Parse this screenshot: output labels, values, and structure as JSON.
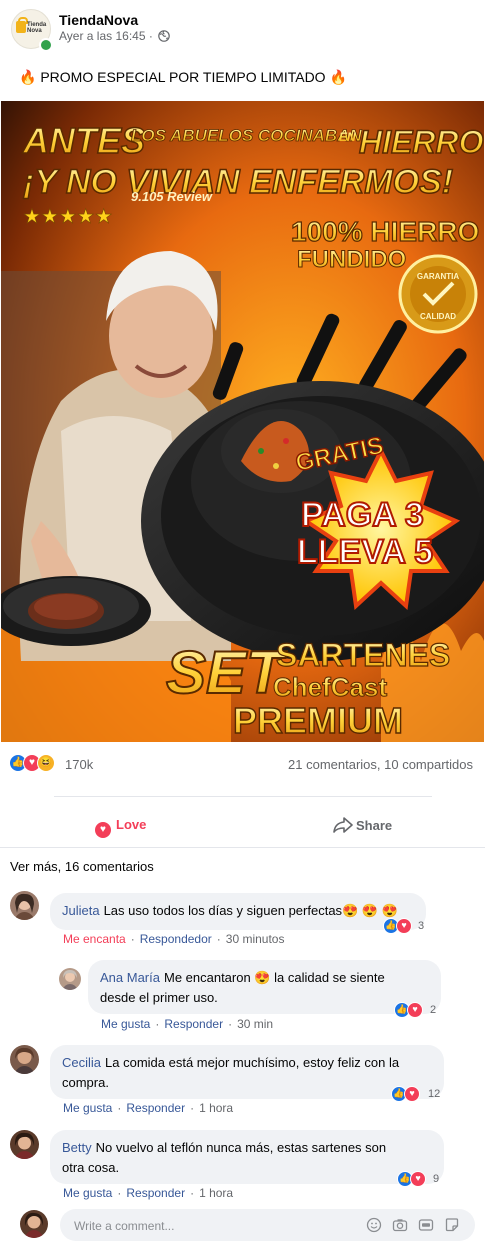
{
  "post": {
    "page_name": "TiendaNova",
    "avatar_text": "Tienda Nova",
    "time": "Ayer a las 16:45",
    "time_sep": "·",
    "caption": "PROMO ESPECIAL POR TIEMPO LIMITADO",
    "caption_emoji": "🔥"
  },
  "ad": {
    "headline_1": "ANTES",
    "headline_1b": "LOS ABUELOS COCINABAN",
    "headline_1c": "EN",
    "headline_1d": "HIERRO",
    "headline_2": "¡Y NO VIVIAN ENFERMOS!",
    "stars": "★★★★★",
    "reviews": "9.105 Review",
    "material_1": "100% HIERRO",
    "material_2": "FUNDIDO",
    "seal_1": "GARANTIA",
    "seal_2": "CALIDAD",
    "gratis": "GRATIS",
    "offer_1": "PAGA 3",
    "offer_2": "LLEVA 5",
    "set_word": "SET",
    "product_1": "SARTENES",
    "product_2": "ChefCast",
    "product_3": "PREMIUM"
  },
  "engagement": {
    "reaction_count": "170k",
    "stats": "21 comentarios, 10 compartidos",
    "love_label": "Love",
    "share_label": "Share",
    "more_comments": "Ver más, 16 comentarios"
  },
  "comments": [
    {
      "name": "Julieta",
      "text": "Las uso todos los días y siguen perfectas😍 😍 😍",
      "action1": "Me encanta",
      "reply": "Respondedor",
      "time": "30 minutos",
      "count": "3"
    },
    {
      "name": "Ana María",
      "text_1": "Me encantaron 😍 la calidad se siente",
      "text_2": "desde el primer uso.",
      "action1": "Me gusta",
      "reply": "Responder",
      "time": "30 min",
      "count": "2"
    },
    {
      "name": "Cecilia",
      "text_1": "La comida está mejor muchísimo, estoy feliz con la",
      "text_2": "compra.",
      "action1": "Me gusta",
      "reply": "Responder",
      "time": "1 hora",
      "count": "12"
    },
    {
      "name": "Betty",
      "text_1": "No vuelvo al teflón nunca más, estas sartenes son",
      "text_2": "otra cosa.",
      "action1": "Me gusta",
      "reply": "Responder",
      "time": "1 hora",
      "count": "9"
    }
  ],
  "composer": {
    "placeholder": "Write a comment..."
  },
  "colors": {
    "like": "#1b74e4",
    "love": "#f33e58",
    "link": "#385898",
    "muted": "#65676b"
  }
}
